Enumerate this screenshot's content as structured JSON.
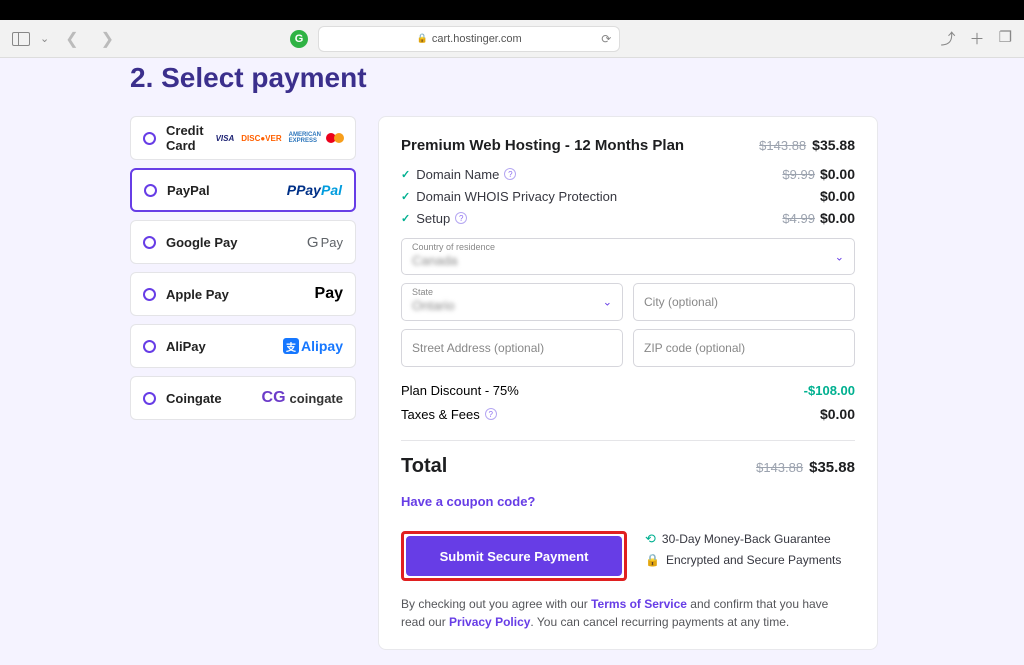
{
  "browser": {
    "url": "cart.hostinger.com"
  },
  "heading": "2. Select payment",
  "payment_options": [
    {
      "label": "Credit Card",
      "selected": false,
      "logos": [
        "visa",
        "discover",
        "amex",
        "mc"
      ]
    },
    {
      "label": "PayPal",
      "selected": true,
      "logos": [
        "paypal"
      ]
    },
    {
      "label": "Google Pay",
      "selected": false,
      "logos": [
        "gpay"
      ]
    },
    {
      "label": "Apple Pay",
      "selected": false,
      "logos": [
        "apay"
      ]
    },
    {
      "label": "AliPay",
      "selected": false,
      "logos": [
        "alipay"
      ]
    },
    {
      "label": "Coingate",
      "selected": false,
      "logos": [
        "coingate"
      ]
    }
  ],
  "product": {
    "title": "Premium Web Hosting - 12 Months Plan",
    "original_price": "$143.88",
    "price": "$35.88",
    "lines": [
      {
        "label": "Domain Name",
        "help": true,
        "strike": "$9.99",
        "price": "$0.00"
      },
      {
        "label": "Domain WHOIS Privacy Protection",
        "help": false,
        "strike": "",
        "price": "$0.00"
      },
      {
        "label": "Setup",
        "help": true,
        "strike": "$4.99",
        "price": "$0.00"
      }
    ]
  },
  "form": {
    "country_label": "Country of residence",
    "country_value": "Canada",
    "state_label": "State",
    "state_value": "Ontario",
    "city_ph": "City (optional)",
    "street_ph": "Street Address (optional)",
    "zip_ph": "ZIP code (optional)"
  },
  "discount": {
    "label": "Plan Discount - 75%",
    "amount": "-$108.00"
  },
  "taxes": {
    "label": "Taxes & Fees",
    "amount": "$0.00"
  },
  "total": {
    "label": "Total",
    "strike": "$143.88",
    "price": "$35.88"
  },
  "coupon_link": "Have a coupon code?",
  "submit_label": "Submit Secure Payment",
  "guarantees": {
    "refund": "30-Day Money-Back Guarantee",
    "secure": "Encrypted and Secure Payments"
  },
  "legal": {
    "pre": "By checking out you agree with our ",
    "tos": "Terms of Service",
    "mid": " and confirm that you have read our ",
    "pp": "Privacy Policy",
    "post": ". You can cancel recurring payments at any time."
  }
}
